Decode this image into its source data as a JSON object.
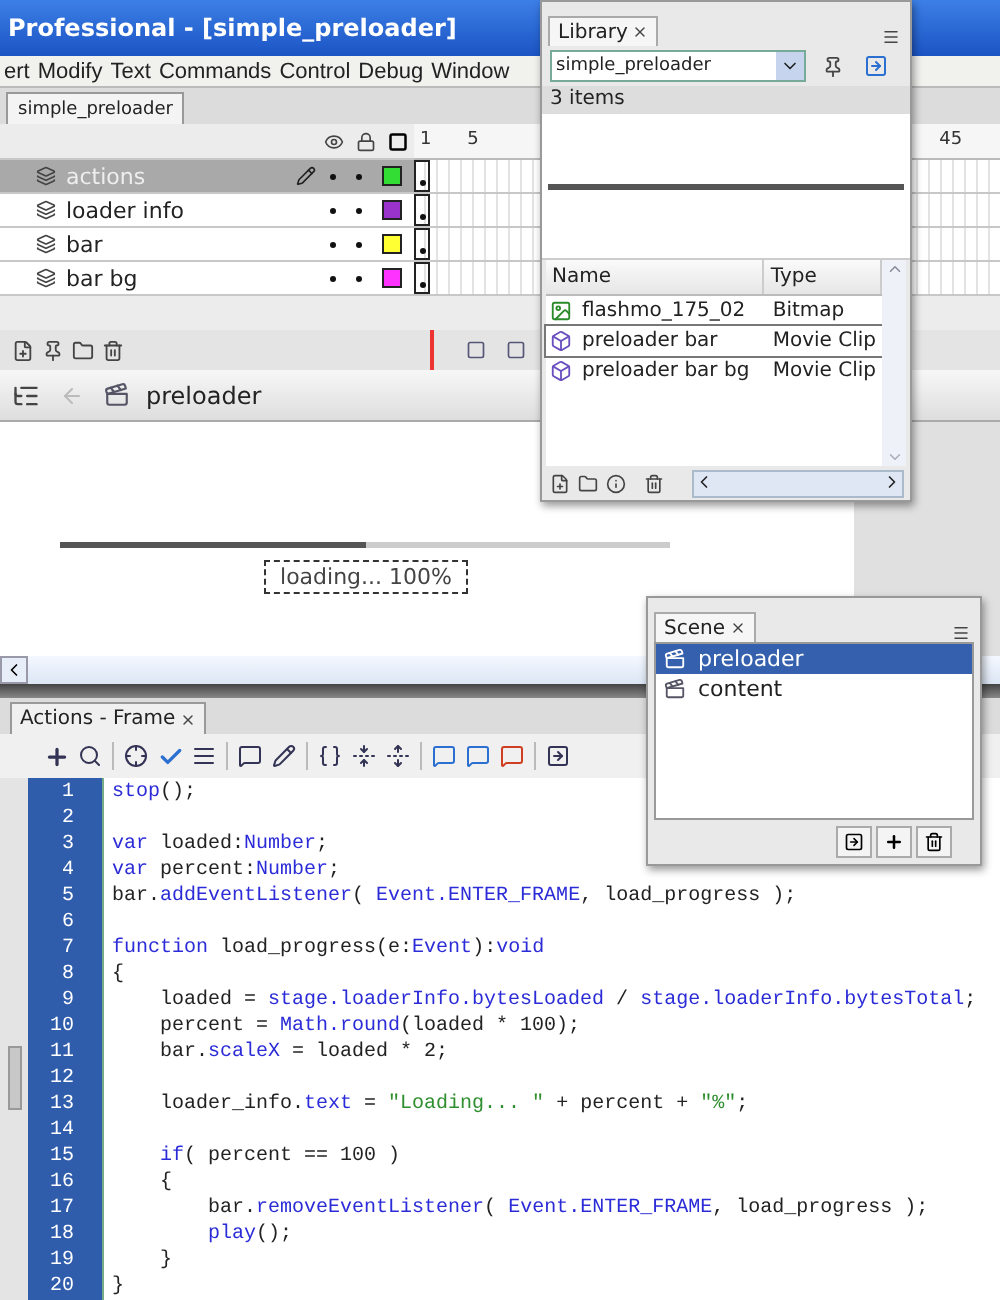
{
  "window": {
    "title": "Professional - [simple_preloader]"
  },
  "menu": [
    "ert",
    "Modify",
    "Text",
    "Commands",
    "Control",
    "Debug",
    "Window"
  ],
  "document_tabs": [
    {
      "label": "simple_preloader",
      "selected": true
    }
  ],
  "timeline": {
    "frame_numbers": [
      "1",
      "5",
      "45"
    ],
    "layers": [
      {
        "name": "actions",
        "selected": true,
        "color": "#33dd33"
      },
      {
        "name": "loader info",
        "selected": false,
        "color": "#9933cc"
      },
      {
        "name": "bar",
        "selected": false,
        "color": "#ffff33"
      },
      {
        "name": "bar bg",
        "selected": false,
        "color": "#ff33ff"
      }
    ]
  },
  "edit_bar": {
    "scene": "preloader"
  },
  "stage": {
    "progress": {
      "level": 0.5
    },
    "text": "loading... 100%"
  },
  "library": {
    "tab": "Library",
    "document": "simple_preloader",
    "count": "3 items",
    "columns": [
      "Name",
      "Type"
    ],
    "items": [
      {
        "name": "flashmo_175_02",
        "type": "Bitmap",
        "kind": "bitmap",
        "selected": false
      },
      {
        "name": "preloader bar",
        "type": "Movie Clip",
        "kind": "movieclip",
        "selected": true
      },
      {
        "name": "preloader bar bg",
        "type": "Movie Clip",
        "kind": "movieclip",
        "selected": false
      }
    ]
  },
  "scene_panel": {
    "tab": "Scene",
    "scenes": [
      {
        "name": "preloader",
        "selected": true
      },
      {
        "name": "content",
        "selected": false
      }
    ]
  },
  "actions": {
    "tab": "Actions - Frame",
    "lines": [
      {
        "number": "1",
        "code": [
          {
            "text": "stop",
            "kind": "keyword"
          },
          {
            "text": "();",
            "kind": "plain"
          }
        ]
      },
      {
        "number": "2"
      },
      {
        "number": "3",
        "code": [
          {
            "text": "var",
            "kind": "keyword"
          },
          {
            "text": " loaded:",
            "kind": "plain"
          },
          {
            "text": "Number",
            "kind": "keyword"
          },
          {
            "text": ";",
            "kind": "plain"
          }
        ]
      },
      {
        "number": "4",
        "code": [
          {
            "text": "var",
            "kind": "keyword"
          },
          {
            "text": " percent:",
            "kind": "plain"
          },
          {
            "text": "Number",
            "kind": "keyword"
          },
          {
            "text": ";",
            "kind": "plain"
          }
        ]
      },
      {
        "number": "5",
        "code": [
          {
            "text": "bar.",
            "kind": "plain"
          },
          {
            "text": "addEventListener",
            "kind": "keyword"
          },
          {
            "text": "( ",
            "kind": "plain"
          },
          {
            "text": "Event.ENTER_FRAME",
            "kind": "keyword"
          },
          {
            "text": ", load_progress );",
            "kind": "plain"
          }
        ]
      },
      {
        "number": "6"
      },
      {
        "number": "7",
        "code": [
          {
            "text": "function",
            "kind": "keyword"
          },
          {
            "text": " load_progress(e:",
            "kind": "plain"
          },
          {
            "text": "Event",
            "kind": "keyword"
          },
          {
            "text": "):",
            "kind": "plain"
          },
          {
            "text": "void",
            "kind": "keyword"
          }
        ]
      },
      {
        "number": "8",
        "code": [
          {
            "text": "{",
            "kind": "plain"
          }
        ]
      },
      {
        "number": "9",
        "code": [
          {
            "text": "    loaded = ",
            "kind": "plain"
          },
          {
            "text": "stage.loaderInfo.bytesLoaded",
            "kind": "keyword"
          },
          {
            "text": " / ",
            "kind": "plain"
          },
          {
            "text": "stage.loaderInfo.bytesTotal",
            "kind": "keyword"
          },
          {
            "text": ";",
            "kind": "plain"
          }
        ]
      },
      {
        "number": "10",
        "code": [
          {
            "text": "    percent = ",
            "kind": "plain"
          },
          {
            "text": "Math.round",
            "kind": "keyword"
          },
          {
            "text": "(loaded * 100);",
            "kind": "plain"
          }
        ]
      },
      {
        "number": "11",
        "code": [
          {
            "text": "    bar.",
            "kind": "plain"
          },
          {
            "text": "scaleX",
            "kind": "keyword"
          },
          {
            "text": " = loaded * 2;",
            "kind": "plain"
          }
        ]
      },
      {
        "number": "12"
      },
      {
        "number": "13",
        "code": [
          {
            "text": "    loader_info.",
            "kind": "plain"
          },
          {
            "text": "text",
            "kind": "keyword"
          },
          {
            "text": " = ",
            "kind": "plain"
          },
          {
            "text": "\"Loading... \"",
            "kind": "string"
          },
          {
            "text": " + percent + ",
            "kind": "plain"
          },
          {
            "text": "\"%\"",
            "kind": "string"
          },
          {
            "text": ";",
            "kind": "plain"
          }
        ]
      },
      {
        "number": "14"
      },
      {
        "number": "15",
        "code": [
          {
            "text": "    if",
            "kind": "keyword"
          },
          {
            "text": "( percent == 100 )",
            "kind": "plain"
          }
        ]
      },
      {
        "number": "16",
        "code": [
          {
            "text": "    {",
            "kind": "plain"
          }
        ]
      },
      {
        "number": "17",
        "code": [
          {
            "text": "        bar.",
            "kind": "plain"
          },
          {
            "text": "removeEventListener",
            "kind": "keyword"
          },
          {
            "text": "( ",
            "kind": "plain"
          },
          {
            "text": "Event.ENTER_FRAME",
            "kind": "keyword"
          },
          {
            "text": ", load_progress );",
            "kind": "plain"
          }
        ]
      },
      {
        "number": "18",
        "code": [
          {
            "text": "        play",
            "kind": "keyword"
          },
          {
            "text": "();",
            "kind": "plain"
          }
        ]
      },
      {
        "number": "19",
        "code": [
          {
            "text": "    }",
            "kind": "plain"
          }
        ]
      },
      {
        "number": "20",
        "code": [
          {
            "text": "}",
            "kind": "plain"
          }
        ]
      }
    ]
  }
}
